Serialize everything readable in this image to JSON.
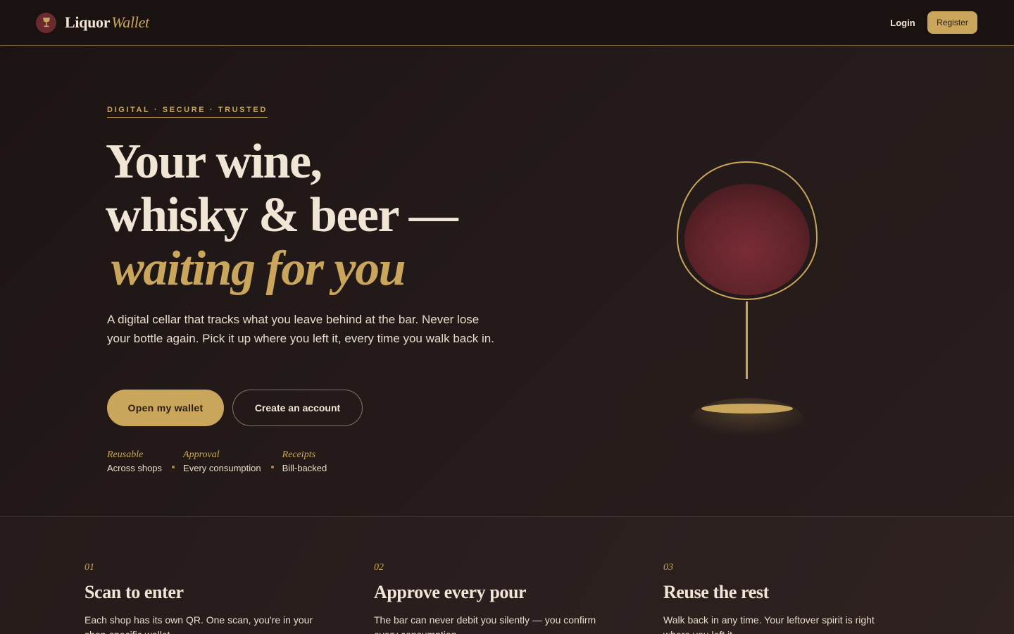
{
  "brand": {
    "name": "Liquor",
    "name_accent": "Wallet"
  },
  "nav": {
    "login": "Login",
    "register": "Register"
  },
  "hero": {
    "eyebrow": "DIGITAL · SECURE · TRUSTED",
    "headline_line1": "Your wine,",
    "headline_line2": "whisky & beer —",
    "headline_accent": "waiting for you",
    "lede": "A digital cellar that tracks what you leave behind at the bar. Never lose your bottle again. Pick it up where you left it, every time you walk back in.",
    "primary_cta": "Open my wallet",
    "secondary_cta": "Create an account",
    "features": [
      {
        "title": "Reusable",
        "sub": "Across shops"
      },
      {
        "title": "Approval",
        "sub": "Every consumption"
      },
      {
        "title": "Receipts",
        "sub": "Bill-backed"
      }
    ]
  },
  "steps": [
    {
      "num": "01",
      "title": "Scan to enter",
      "body": "Each shop has its own QR. One scan, you're in your shop-specific wallet."
    },
    {
      "num": "02",
      "title": "Approve every pour",
      "body": "The bar can never debit you silently — you confirm every consumption."
    },
    {
      "num": "03",
      "title": "Reuse the rest",
      "body": "Walk back in any time. Your leftover spirit is right where you left it."
    }
  ],
  "colors": {
    "gold": "#c9a65c",
    "wine": "#6b2a2f",
    "background": "#1f1716",
    "cream": "#f1e6d6"
  },
  "icons": {
    "brand": "wine-glass-icon",
    "hero_art": "wine-glass-illustration"
  }
}
